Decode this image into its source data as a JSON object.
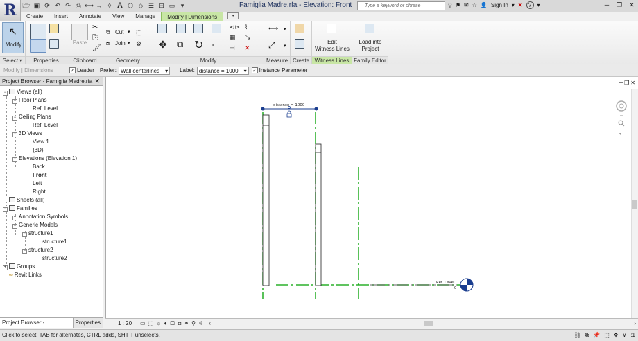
{
  "titlebar": {
    "doc_title": "Famiglia Madre.rfa - Elevation: Front",
    "search_placeholder": "Type a keyword or phrase",
    "sign_in": "Sign In",
    "help": "?"
  },
  "tabs": [
    "Create",
    "Insert",
    "Annotate",
    "View",
    "Manage",
    "Modify | Dimensions"
  ],
  "ribbon": {
    "modify_label": "Modify",
    "paste_label": "Paste",
    "cut_label": "Cut",
    "join_label": "Join",
    "edit_witness_line1": "Edit",
    "edit_witness_line2": "Witness Lines",
    "load_into_line1": "Load into",
    "load_into_line2": "Project",
    "panels": {
      "select": "Select",
      "properties": "Properties",
      "clipboard": "Clipboard",
      "geometry": "Geometry",
      "modify": "Modify",
      "measure": "Measure",
      "create": "Create",
      "witness": "Witness Lines",
      "family_editor": "Family Editor"
    }
  },
  "optbar": {
    "context": "Modify | Dimensions",
    "leader": "Leader",
    "prefer_label": "Prefer:",
    "prefer_value": "Wall centerlines",
    "label_label": "Label:",
    "label_value": "distance = 1000",
    "instance_param": "Instance Parameter"
  },
  "project_browser": {
    "title": "Project Browser - Famiglia Madre.rfa",
    "items": [
      "Views (all)",
      "Floor Plans",
      "Ref. Level",
      "Ceiling Plans",
      "Ref. Level",
      "3D Views",
      "View 1",
      "{3D}",
      "Elevations (Elevation 1)",
      "Back",
      "Front",
      "Left",
      "Right",
      "Sheets (all)",
      "Families",
      "Annotation Symbols",
      "Generic Models",
      "structure1",
      "structure1",
      "structure2",
      "structure2",
      "Groups",
      "Revit Links"
    ],
    "tab_browser": "Project Browser - Famiglia...",
    "tab_properties": "Properties"
  },
  "drawing": {
    "dimension_text": "distance = 1000",
    "level_text": "Ref. Level",
    "level_value": "0"
  },
  "viewbar": {
    "scale": "1 : 20"
  },
  "status": {
    "text": "Click to select, TAB for alternates, CTRL adds, SHIFT unselects.",
    "filter_count": ":1"
  },
  "colors": {
    "accent_tab": "#c8e6a5",
    "dimension_blue": "#1a3d8f",
    "centerline_green": "#00a000"
  }
}
